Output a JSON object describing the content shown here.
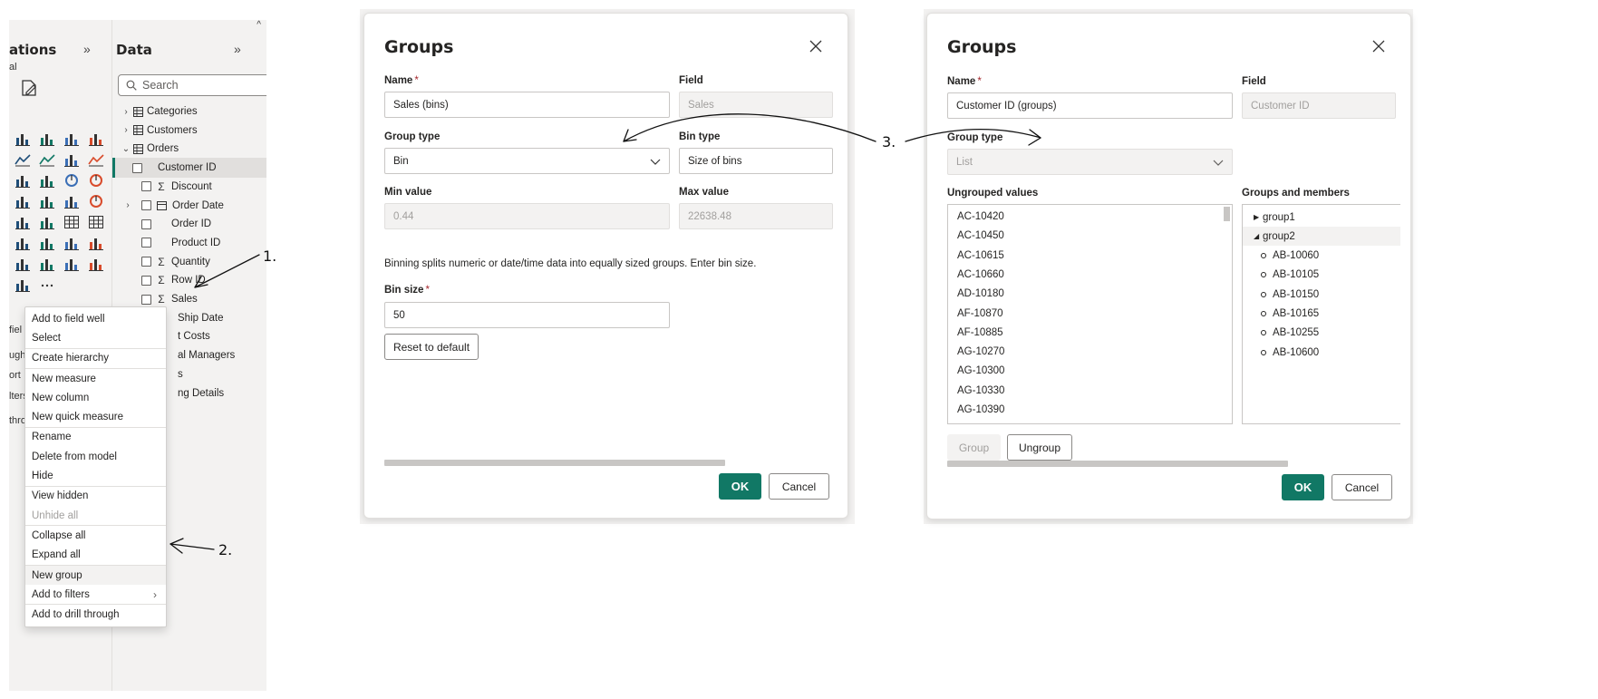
{
  "left_pane": {
    "visualizations_title": "ations",
    "visualizations_sub": "al",
    "data_title": "Data",
    "search_placeholder": "Search",
    "tree": [
      {
        "label": "Categories",
        "kind": "table",
        "expanded": false
      },
      {
        "label": "Customers",
        "kind": "table",
        "expanded": false
      },
      {
        "label": "Orders",
        "kind": "table",
        "expanded": true
      },
      {
        "label": "Customer ID",
        "kind": "field",
        "selected": true
      },
      {
        "label": "Discount",
        "kind": "measure"
      },
      {
        "label": "Order Date",
        "kind": "date"
      },
      {
        "label": "Order ID",
        "kind": "field"
      },
      {
        "label": "Product ID",
        "kind": "field"
      },
      {
        "label": "Quantity",
        "kind": "measure"
      },
      {
        "label": "Row ID",
        "kind": "measure"
      },
      {
        "label": "Sales",
        "kind": "measure"
      },
      {
        "label": "Ship Date",
        "kind": "partial"
      },
      {
        "label": "t Costs",
        "kind": "partial"
      },
      {
        "label": "al Managers",
        "kind": "partial"
      },
      {
        "label": "s",
        "kind": "partial"
      },
      {
        "label": "ng Details",
        "kind": "partial"
      }
    ],
    "strip_partial_texts": [
      "fiel",
      "ugh",
      "ort",
      "lters",
      "thro"
    ]
  },
  "context_menu": {
    "items": [
      {
        "label": "Add to field well"
      },
      {
        "label": "Select",
        "sep_after": true
      },
      {
        "label": "Create hierarchy",
        "sep_after": true
      },
      {
        "label": "New measure"
      },
      {
        "label": "New column"
      },
      {
        "label": "New quick measure",
        "sep_after": true
      },
      {
        "label": "Rename"
      },
      {
        "label": "Delete from model"
      },
      {
        "label": "Hide",
        "sep_after": true
      },
      {
        "label": "View hidden"
      },
      {
        "label": "Unhide all",
        "disabled": true,
        "sep_after": true
      },
      {
        "label": "Collapse all"
      },
      {
        "label": "Expand all",
        "sep_after": true
      },
      {
        "label": "New group",
        "highlighted": true
      },
      {
        "label": "Add to filters",
        "submenu": true,
        "sep_after": true
      },
      {
        "label": "Add to drill through"
      }
    ]
  },
  "annotations": {
    "a1": "1.",
    "a2": "2.",
    "a3": "3."
  },
  "dialog_bins": {
    "title": "Groups",
    "name_label": "Name",
    "name_required": "*",
    "name_value": "Sales (bins)",
    "field_label": "Field",
    "field_value": "Sales",
    "group_type_label": "Group type",
    "group_type_value": "Bin",
    "bin_type_label": "Bin type",
    "bin_type_value": "Size of bins",
    "min_label": "Min value",
    "min_value": "0.44",
    "max_label": "Max value",
    "max_value": "22638.48",
    "help_text": "Binning splits numeric or date/time data into equally sized groups. Enter bin size.",
    "bin_size_label": "Bin size",
    "bin_size_required": "*",
    "bin_size_value": "50",
    "reset_label": "Reset to default",
    "ok_label": "OK",
    "cancel_label": "Cancel"
  },
  "dialog_list": {
    "title": "Groups",
    "name_label": "Name",
    "name_required": "*",
    "name_value": "Customer ID (groups)",
    "field_label": "Field",
    "field_value": "Customer ID",
    "group_type_label": "Group type",
    "group_type_value": "List",
    "ungrouped_label": "Ungrouped values",
    "ungrouped_values": [
      "AC-10420",
      "AC-10450",
      "AC-10615",
      "AC-10660",
      "AD-10180",
      "AF-10870",
      "AF-10885",
      "AG-10270",
      "AG-10300",
      "AG-10330",
      "AG-10390"
    ],
    "groups_label": "Groups and members",
    "groups": [
      {
        "name": "group1",
        "expanded": false,
        "members": []
      },
      {
        "name": "group2",
        "expanded": true,
        "members": [
          "AB-10060",
          "AB-10105",
          "AB-10150",
          "AB-10165",
          "AB-10255",
          "AB-10600"
        ]
      }
    ],
    "group_btn": "Group",
    "ungroup_btn": "Ungroup",
    "ok_label": "OK",
    "cancel_label": "Cancel"
  },
  "colors": {
    "accent": "#117865",
    "required": "#a4262c",
    "panel": "#f3f2f1"
  }
}
